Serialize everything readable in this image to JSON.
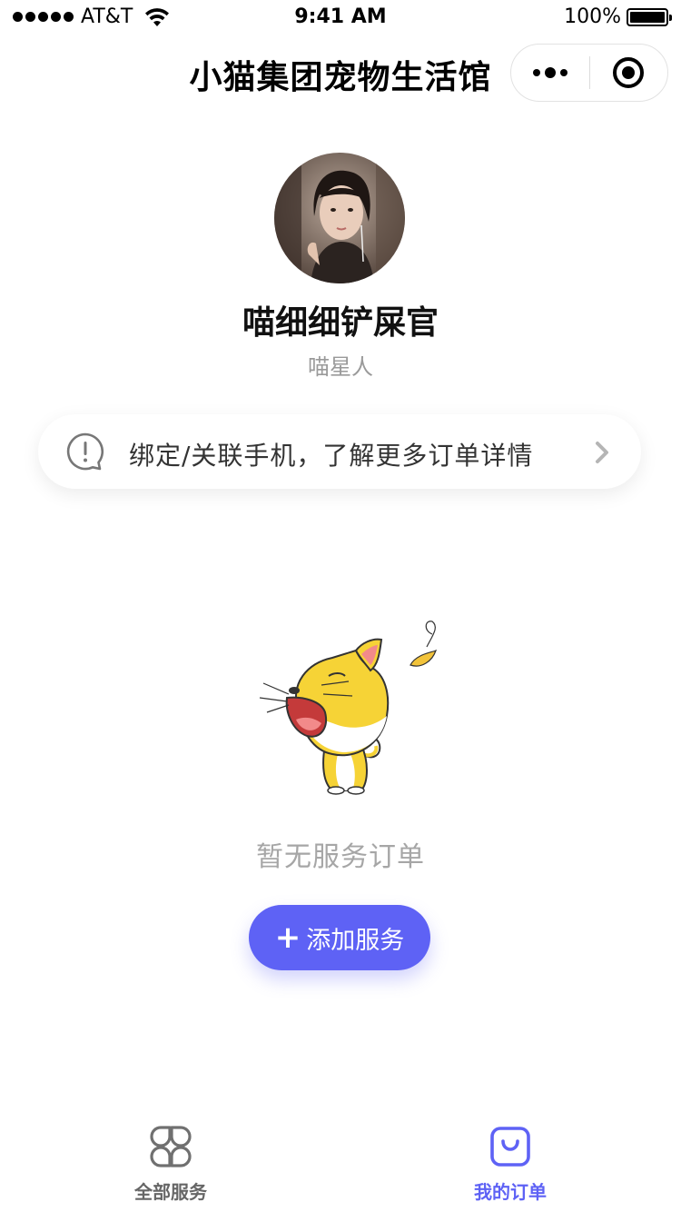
{
  "status_bar": {
    "carrier": "AT&T",
    "time": "9:41 AM",
    "battery": "100%"
  },
  "nav": {
    "title": "小猫集团宠物生活馆"
  },
  "profile": {
    "name": "喵细细铲屎官",
    "tag": "喵星人"
  },
  "bind_phone": {
    "text": "绑定/关联手机，了解更多订单详情"
  },
  "empty_state": {
    "text": "暂无服务订单",
    "add_button": "添加服务"
  },
  "tabs": [
    {
      "label": "全部服务",
      "icon": "grid-icon",
      "active": false
    },
    {
      "label": "我的订单",
      "icon": "bag-icon",
      "active": true
    }
  ],
  "colors": {
    "accent": "#5e62f5",
    "text_muted": "#a6a6a6",
    "cat_yellow": "#f6d336"
  }
}
